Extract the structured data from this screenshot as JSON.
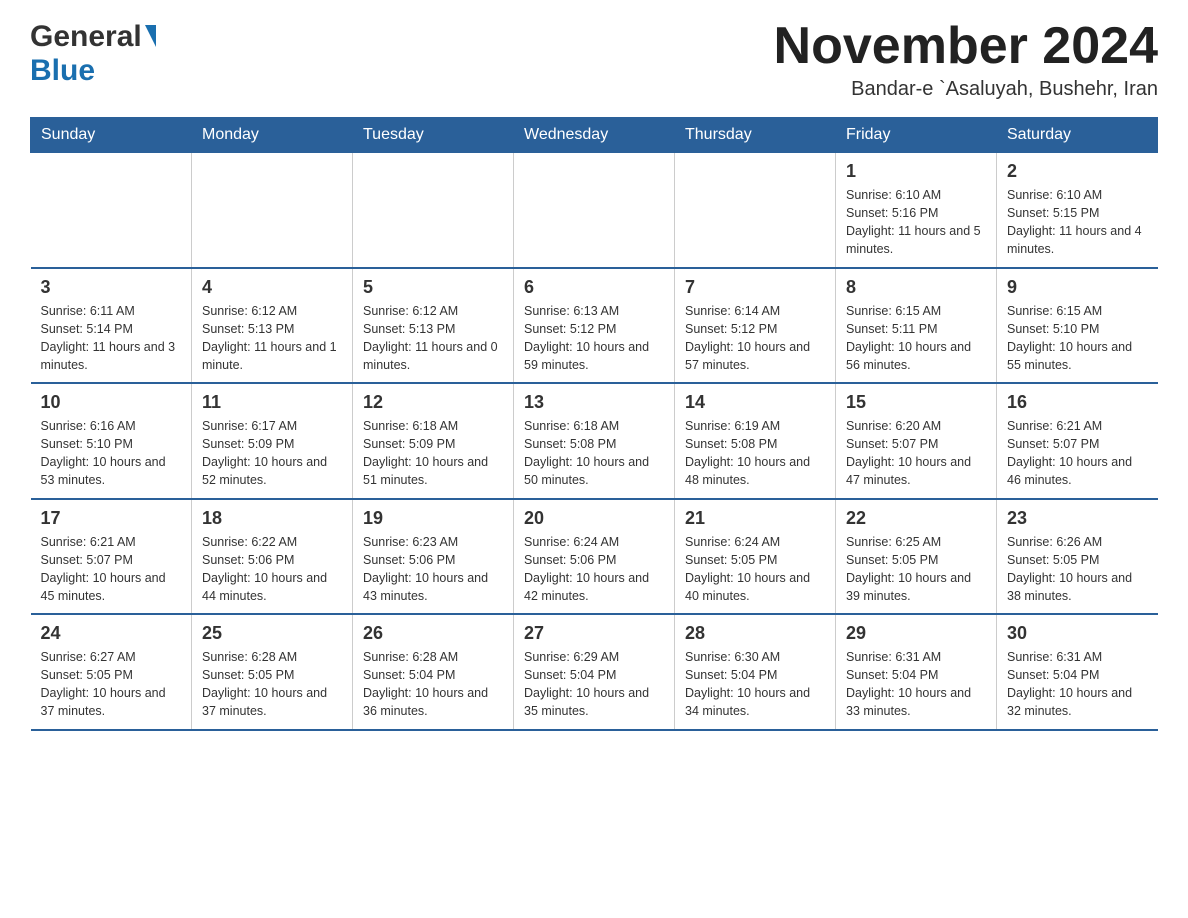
{
  "header": {
    "logo": {
      "general": "General",
      "blue": "Blue",
      "triangle_color": "#1a6faf"
    },
    "title": "November 2024",
    "subtitle": "Bandar-e `Asaluyah, Bushehr, Iran"
  },
  "calendar": {
    "days_of_week": [
      "Sunday",
      "Monday",
      "Tuesday",
      "Wednesday",
      "Thursday",
      "Friday",
      "Saturday"
    ],
    "weeks": [
      [
        {
          "day": "",
          "info": ""
        },
        {
          "day": "",
          "info": ""
        },
        {
          "day": "",
          "info": ""
        },
        {
          "day": "",
          "info": ""
        },
        {
          "day": "",
          "info": ""
        },
        {
          "day": "1",
          "info": "Sunrise: 6:10 AM\nSunset: 5:16 PM\nDaylight: 11 hours and 5 minutes."
        },
        {
          "day": "2",
          "info": "Sunrise: 6:10 AM\nSunset: 5:15 PM\nDaylight: 11 hours and 4 minutes."
        }
      ],
      [
        {
          "day": "3",
          "info": "Sunrise: 6:11 AM\nSunset: 5:14 PM\nDaylight: 11 hours and 3 minutes."
        },
        {
          "day": "4",
          "info": "Sunrise: 6:12 AM\nSunset: 5:13 PM\nDaylight: 11 hours and 1 minute."
        },
        {
          "day": "5",
          "info": "Sunrise: 6:12 AM\nSunset: 5:13 PM\nDaylight: 11 hours and 0 minutes."
        },
        {
          "day": "6",
          "info": "Sunrise: 6:13 AM\nSunset: 5:12 PM\nDaylight: 10 hours and 59 minutes."
        },
        {
          "day": "7",
          "info": "Sunrise: 6:14 AM\nSunset: 5:12 PM\nDaylight: 10 hours and 57 minutes."
        },
        {
          "day": "8",
          "info": "Sunrise: 6:15 AM\nSunset: 5:11 PM\nDaylight: 10 hours and 56 minutes."
        },
        {
          "day": "9",
          "info": "Sunrise: 6:15 AM\nSunset: 5:10 PM\nDaylight: 10 hours and 55 minutes."
        }
      ],
      [
        {
          "day": "10",
          "info": "Sunrise: 6:16 AM\nSunset: 5:10 PM\nDaylight: 10 hours and 53 minutes."
        },
        {
          "day": "11",
          "info": "Sunrise: 6:17 AM\nSunset: 5:09 PM\nDaylight: 10 hours and 52 minutes."
        },
        {
          "day": "12",
          "info": "Sunrise: 6:18 AM\nSunset: 5:09 PM\nDaylight: 10 hours and 51 minutes."
        },
        {
          "day": "13",
          "info": "Sunrise: 6:18 AM\nSunset: 5:08 PM\nDaylight: 10 hours and 50 minutes."
        },
        {
          "day": "14",
          "info": "Sunrise: 6:19 AM\nSunset: 5:08 PM\nDaylight: 10 hours and 48 minutes."
        },
        {
          "day": "15",
          "info": "Sunrise: 6:20 AM\nSunset: 5:07 PM\nDaylight: 10 hours and 47 minutes."
        },
        {
          "day": "16",
          "info": "Sunrise: 6:21 AM\nSunset: 5:07 PM\nDaylight: 10 hours and 46 minutes."
        }
      ],
      [
        {
          "day": "17",
          "info": "Sunrise: 6:21 AM\nSunset: 5:07 PM\nDaylight: 10 hours and 45 minutes."
        },
        {
          "day": "18",
          "info": "Sunrise: 6:22 AM\nSunset: 5:06 PM\nDaylight: 10 hours and 44 minutes."
        },
        {
          "day": "19",
          "info": "Sunrise: 6:23 AM\nSunset: 5:06 PM\nDaylight: 10 hours and 43 minutes."
        },
        {
          "day": "20",
          "info": "Sunrise: 6:24 AM\nSunset: 5:06 PM\nDaylight: 10 hours and 42 minutes."
        },
        {
          "day": "21",
          "info": "Sunrise: 6:24 AM\nSunset: 5:05 PM\nDaylight: 10 hours and 40 minutes."
        },
        {
          "day": "22",
          "info": "Sunrise: 6:25 AM\nSunset: 5:05 PM\nDaylight: 10 hours and 39 minutes."
        },
        {
          "day": "23",
          "info": "Sunrise: 6:26 AM\nSunset: 5:05 PM\nDaylight: 10 hours and 38 minutes."
        }
      ],
      [
        {
          "day": "24",
          "info": "Sunrise: 6:27 AM\nSunset: 5:05 PM\nDaylight: 10 hours and 37 minutes."
        },
        {
          "day": "25",
          "info": "Sunrise: 6:28 AM\nSunset: 5:05 PM\nDaylight: 10 hours and 37 minutes."
        },
        {
          "day": "26",
          "info": "Sunrise: 6:28 AM\nSunset: 5:04 PM\nDaylight: 10 hours and 36 minutes."
        },
        {
          "day": "27",
          "info": "Sunrise: 6:29 AM\nSunset: 5:04 PM\nDaylight: 10 hours and 35 minutes."
        },
        {
          "day": "28",
          "info": "Sunrise: 6:30 AM\nSunset: 5:04 PM\nDaylight: 10 hours and 34 minutes."
        },
        {
          "day": "29",
          "info": "Sunrise: 6:31 AM\nSunset: 5:04 PM\nDaylight: 10 hours and 33 minutes."
        },
        {
          "day": "30",
          "info": "Sunrise: 6:31 AM\nSunset: 5:04 PM\nDaylight: 10 hours and 32 minutes."
        }
      ]
    ]
  }
}
